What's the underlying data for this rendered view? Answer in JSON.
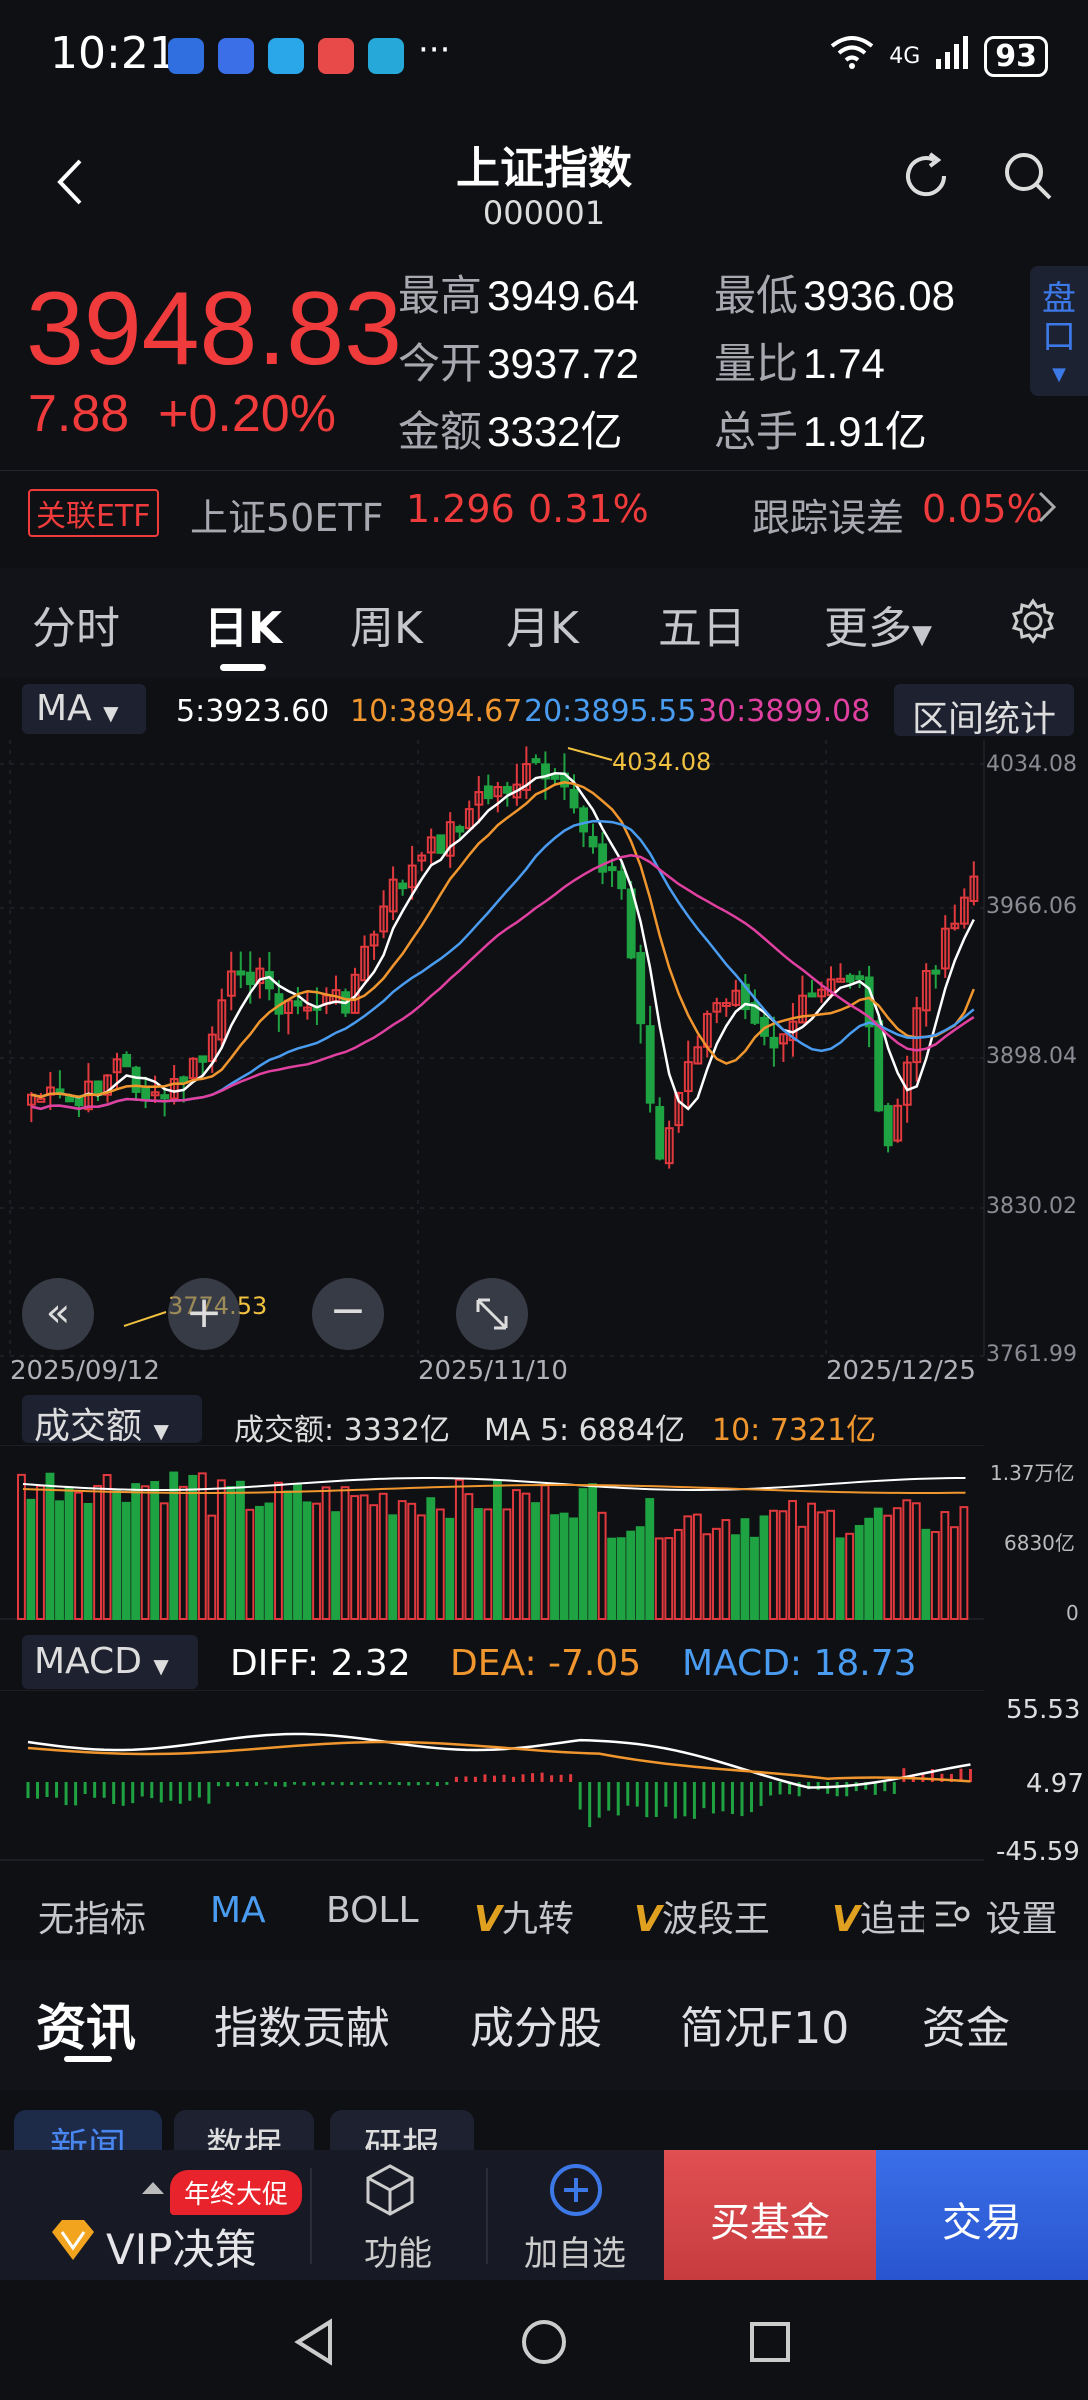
{
  "status": {
    "time": "10:21",
    "signal": "4G",
    "battery": "93"
  },
  "header": {
    "title": "上证指数",
    "code": "000001"
  },
  "quote": {
    "price": "3948.83",
    "change": "7.88",
    "change_pct": "+0.20%",
    "high_label": "最高",
    "high": "3949.64",
    "low_label": "最低",
    "low": "3936.08",
    "open_label": "今开",
    "open": "3937.72",
    "ratio_label": "量比",
    "ratio": "1.74",
    "amount_label": "金额",
    "amount": "3332亿",
    "hands_label": "总手",
    "hands": "1.91亿",
    "pankou": "盘口"
  },
  "etf": {
    "tag": "关联ETF",
    "name": "上证50ETF",
    "price": "1.296",
    "pct": "0.31%",
    "err_label": "跟踪误差",
    "err": "0.05%"
  },
  "ktabs": [
    "分时",
    "日K",
    "周K",
    "月K",
    "五日",
    "更多"
  ],
  "ma_row": {
    "ma_select": "MA",
    "ma5": "5:3923.60",
    "ma10": "10:3894.67",
    "ma20": "20:3895.55",
    "ma30": "30:3899.08",
    "stats": "区间统计"
  },
  "chart_data": {
    "type": "candlestick",
    "y_ticks": [
      "4034.08",
      "3966.06",
      "3898.04",
      "3830.02",
      "3761.99"
    ],
    "dates": [
      "2025/09/12",
      "2025/11/10",
      "2025/12/25"
    ],
    "high_label": "4034.08",
    "low_label": "3774.53",
    "ylim": [
      3761.99,
      4034.08
    ],
    "ma_colors": {
      "ma5": "#ffffff",
      "ma10": "#f0962e",
      "ma20": "#4a9cf0",
      "ma30": "#e040a0"
    }
  },
  "volume": {
    "select": "成交额",
    "label": "成交额: 3332亿",
    "ma5": "MA 5: 6884亿",
    "ma10": "10: 7321亿",
    "ticks": [
      "1.37万亿",
      "6830亿",
      "0"
    ]
  },
  "macd": {
    "select": "MACD",
    "diff": "DIFF: 2.32",
    "dea": "DEA: -7.05",
    "macd": "MACD: 18.73",
    "ticks": [
      "55.53",
      "4.97",
      "-45.59"
    ]
  },
  "indicators": [
    "无指标",
    "MA",
    "BOLL",
    "九转",
    "波段王",
    "追击",
    "设置"
  ],
  "news_tabs": [
    "资讯",
    "指数贡献",
    "成分股",
    "简况F10",
    "资金"
  ],
  "sub_tabs": [
    "新闻",
    "数据",
    "研报"
  ],
  "bottom": {
    "promo": "年终大促",
    "vip": "VIP决策",
    "func": "功能",
    "add": "加自选",
    "buy_fund": "买基金",
    "trade": "交易"
  }
}
